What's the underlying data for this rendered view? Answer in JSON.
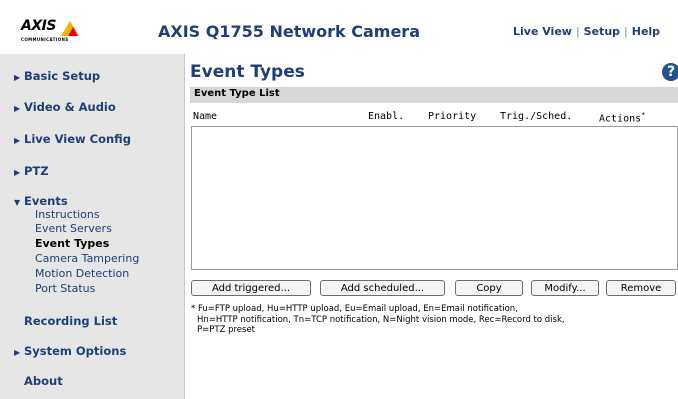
{
  "header": {
    "logo_text": "AXIS",
    "logo_subtext": "COMMUNICATIONS",
    "title": "AXIS Q1755 Network Camera",
    "nav": {
      "live_view": "Live View",
      "separator": "|",
      "setup": "Setup",
      "help": "Help"
    }
  },
  "sidebar": {
    "basic_setup": "Basic Setup",
    "video_audio": "Video & Audio",
    "live_view_config": "Live View Config",
    "ptz": "PTZ",
    "events": "Events",
    "events_sub": {
      "instructions": "Instructions",
      "event_servers": "Event Servers",
      "event_types": "Event Types",
      "camera_tampering": "Camera Tampering",
      "motion_detection": "Motion Detection",
      "port_status": "Port Status"
    },
    "recording_list": "Recording List",
    "system_options": "System Options",
    "about": "About"
  },
  "main": {
    "title": "Event Types",
    "section_title": "Event Type List",
    "columns": {
      "name": "Name",
      "enabled": "Enabl.",
      "priority": "Priority",
      "trig_sched": "Trig./Sched.",
      "actions": "Actions",
      "actions_mark": "*"
    },
    "rows": [],
    "buttons": {
      "add_triggered": "Add triggered...",
      "add_scheduled": "Add scheduled...",
      "copy": "Copy",
      "modify": "Modify...",
      "remove": "Remove"
    },
    "footnote": {
      "line1": "* Fu=FTP upload, Hu=HTTP upload, Eu=Email upload, En=Email notification,",
      "line2": "Hn=HTTP notification, Tn=TCP notification, N=Night vision mode, Rec=Record to disk,",
      "line3": "P=PTZ preset"
    }
  },
  "colors": {
    "brand_blue": "#1e3f77",
    "sidebar_bg": "#e6e6e6",
    "section_bar": "#d8d8d8",
    "logo_yellow": "#f2b400",
    "logo_red": "#e2001a"
  },
  "icons": {
    "help": "help-icon",
    "nav_arrow_right": "chevron-right-icon",
    "nav_arrow_down": "chevron-down-icon"
  }
}
